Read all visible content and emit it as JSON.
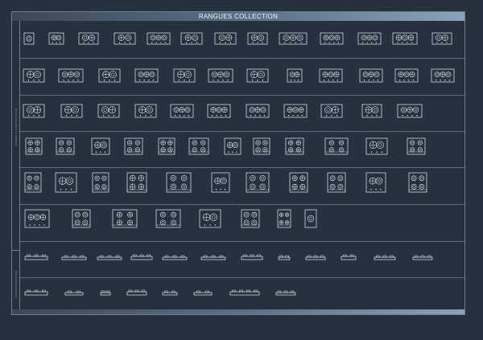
{
  "sheet": {
    "title": "RANGUES COLLECTION",
    "side_labels": [
      "RANGES & COOKTOPS PLAN",
      "RANGES ELEVATION"
    ]
  },
  "rows": [
    {
      "kind": "plan",
      "count": 13
    },
    {
      "kind": "plan",
      "count": 12
    },
    {
      "kind": "plan",
      "count": 11
    },
    {
      "kind": "plan",
      "count": 11
    },
    {
      "kind": "plan",
      "count": 11
    },
    {
      "kind": "plan",
      "count": 8
    },
    {
      "kind": "elevation",
      "count": 11
    },
    {
      "kind": "elevation",
      "count": 8
    }
  ]
}
